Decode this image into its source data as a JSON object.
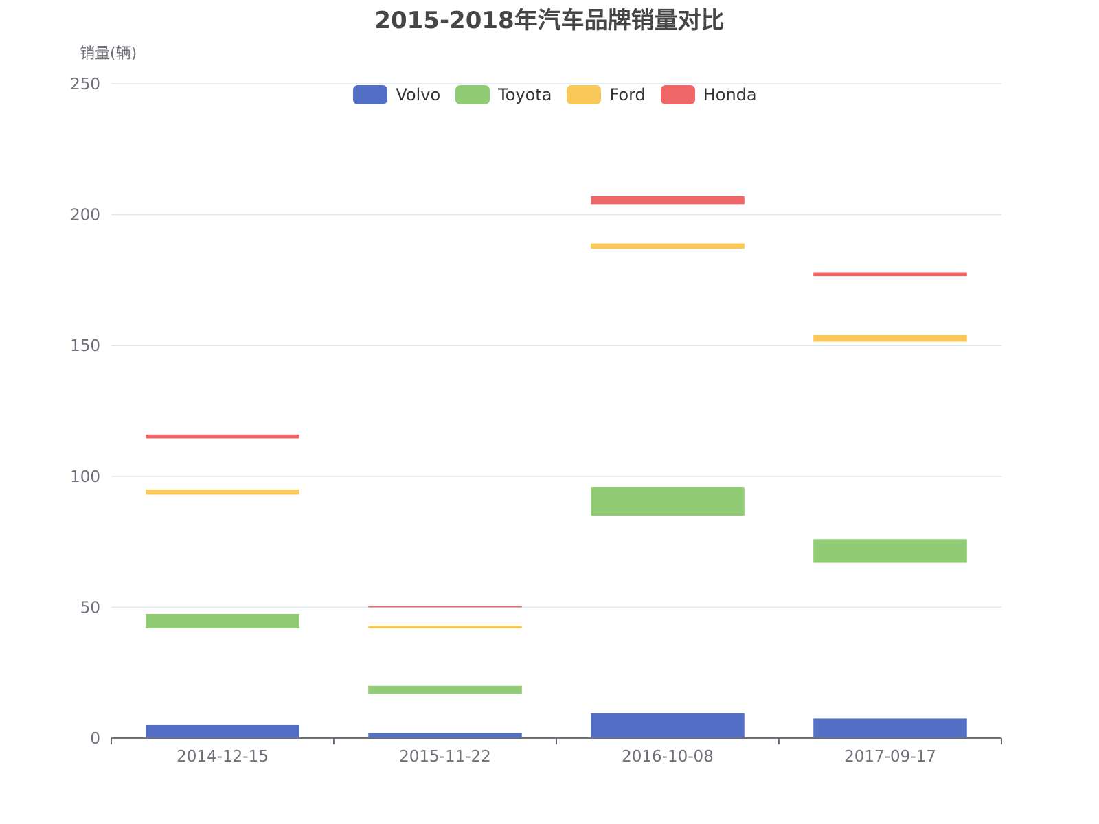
{
  "chart_data": {
    "type": "bar",
    "title": "2015-2018年汽车品牌销量对比",
    "ylabel": "销量(辆)",
    "xlabel": "",
    "ylim": [
      0,
      250
    ],
    "yticks": [
      0,
      50,
      100,
      150,
      200,
      250
    ],
    "categories": [
      "2014-12-15",
      "2015-11-22",
      "2016-10-08",
      "2017-09-17"
    ],
    "grid": true,
    "legend_position": "top-center",
    "series": [
      {
        "name": "Volvo",
        "color": "#5470c6",
        "low": [
          0,
          0,
          0,
          0
        ],
        "high": [
          5,
          2,
          9.5,
          7.5
        ]
      },
      {
        "name": "Toyota",
        "color": "#91cc75",
        "low": [
          42,
          17,
          85,
          67
        ],
        "high": [
          47.5,
          20,
          96,
          76
        ]
      },
      {
        "name": "Ford",
        "color": "#fac858",
        "low": [
          93,
          42,
          187,
          151.5
        ],
        "high": [
          95,
          43,
          189,
          154
        ]
      },
      {
        "name": "Honda",
        "color": "#ee6666",
        "low": [
          114.5,
          50,
          204,
          176.5
        ],
        "high": [
          116,
          50.5,
          207,
          178
        ]
      }
    ]
  }
}
